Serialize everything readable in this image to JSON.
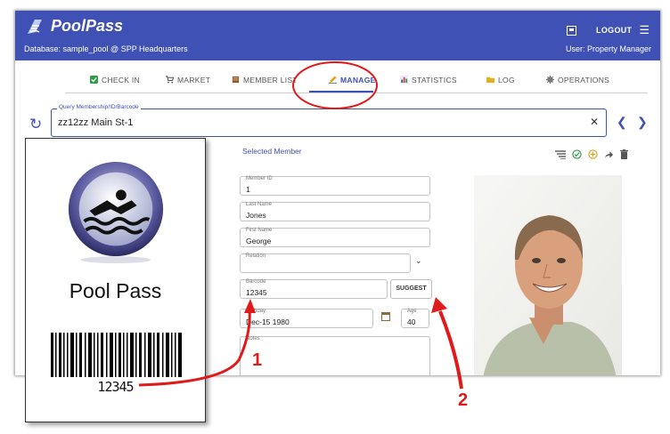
{
  "app": {
    "name": "PoolPass",
    "database": "Database: sample_pool @ SPP Headquarters",
    "user": "User: Property Manager",
    "logout": "LOGOUT"
  },
  "tabs": [
    {
      "label": "CHECK IN",
      "icon": "checkbox-icon",
      "color": "#2e9d4a"
    },
    {
      "label": "MARKET",
      "icon": "cart-icon",
      "color": "#555555"
    },
    {
      "label": "MEMBER LIST",
      "icon": "book-icon",
      "color": "#8a5a2b"
    },
    {
      "label": "MANAGE",
      "icon": "pencil-icon",
      "color": "#e0a020",
      "active": true
    },
    {
      "label": "STATISTICS",
      "icon": "bar-chart-icon",
      "color": "#3f51b5"
    },
    {
      "label": "LOG",
      "icon": "folder-icon",
      "color": "#e0b020"
    },
    {
      "label": "OPERATIONS",
      "icon": "gear-icon",
      "color": "#777777"
    }
  ],
  "query": {
    "label": "Query Membership/ID/Barcode",
    "value": "zz12zz Main St-1"
  },
  "member": {
    "section_title": "Selected Member",
    "member_id_label": "Member ID",
    "member_id": "1",
    "last_name_label": "Last Name",
    "last_name": "Jones",
    "first_name_label": "First Name",
    "first_name": "George",
    "relation_label": "Relation",
    "relation": "",
    "barcode_label": "Barcode",
    "barcode": "12345",
    "suggest_label": "SUGGEST",
    "birthday_label": "Birthday",
    "birthday": "Dec-15 1980",
    "age_label": "Age",
    "age": "40",
    "notes_label": "Notes"
  },
  "card": {
    "title": "Pool Pass",
    "number": "12345"
  },
  "callouts": {
    "one": "1",
    "two": "2",
    "color": "#e01a1a"
  },
  "colors": {
    "primary": "#3f51b5",
    "annotation": "#e01a1a"
  }
}
